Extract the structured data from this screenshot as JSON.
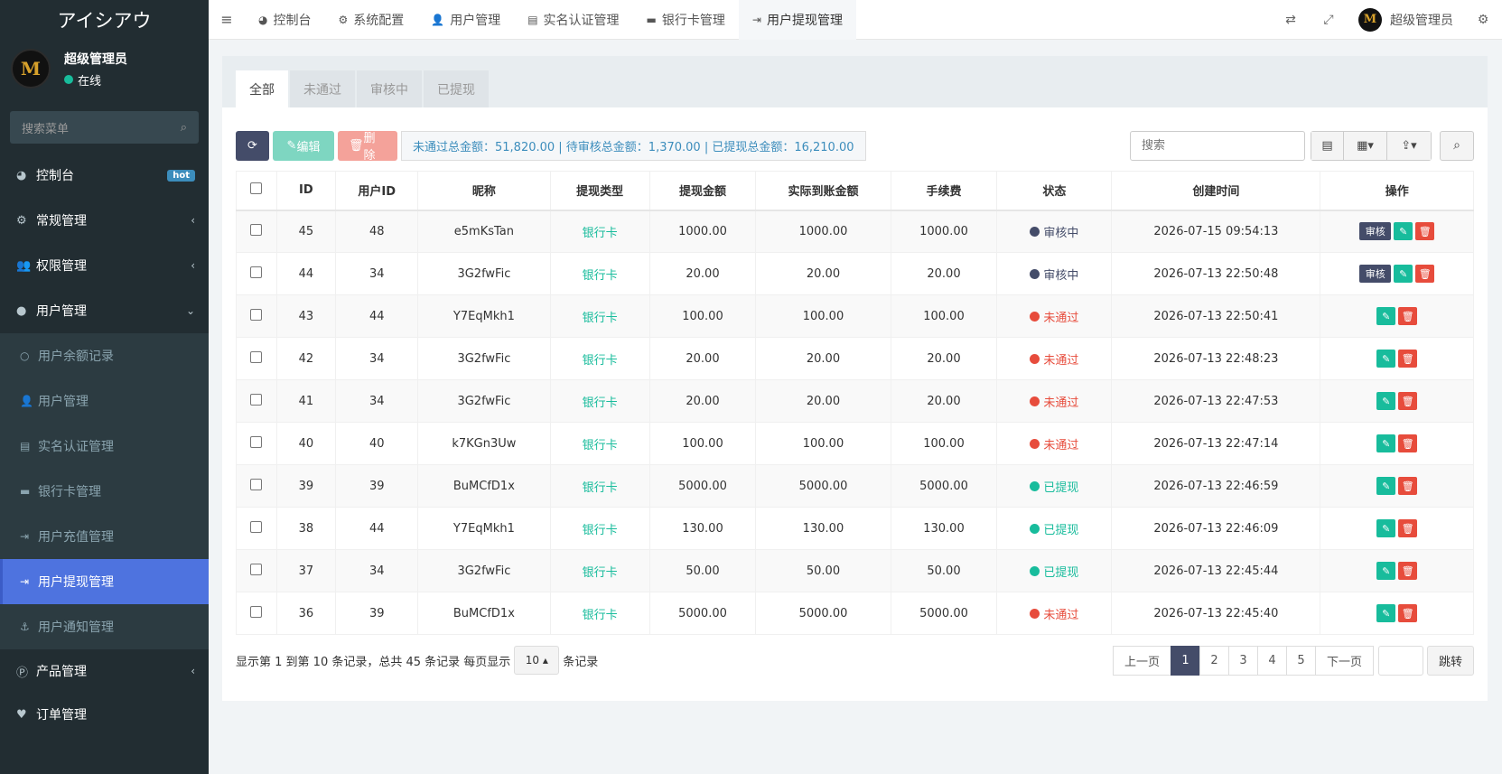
{
  "brand": "アイシアウ",
  "user": {
    "name": "超级管理员",
    "status": "在线",
    "avatar_letter": "M"
  },
  "sidebar": {
    "search_placeholder": "搜索菜单",
    "items": [
      {
        "label": "控制台",
        "icon": "dashboard-icon",
        "glyph": "◕",
        "badge": "hot"
      },
      {
        "label": "常规管理",
        "icon": "cogs-icon",
        "glyph": "⚙",
        "chevron": "‹"
      },
      {
        "label": "权限管理",
        "icon": "group-icon",
        "glyph": "👥",
        "chevron": "‹"
      },
      {
        "label": "用户管理",
        "icon": "user-circle-icon",
        "glyph": "●",
        "chevron": "⌄"
      }
    ],
    "subitems": [
      {
        "label": "用户余额记录",
        "glyph": "○"
      },
      {
        "label": "用户管理",
        "glyph": "👤"
      },
      {
        "label": "实名认证管理",
        "glyph": "▤"
      },
      {
        "label": "银行卡管理",
        "glyph": "▬"
      },
      {
        "label": "用户充值管理",
        "glyph": "⇥"
      },
      {
        "label": "用户提现管理",
        "glyph": "⇥",
        "active": true
      },
      {
        "label": "用户通知管理",
        "glyph": "⚓"
      }
    ],
    "bottom_items": [
      {
        "label": "产品管理",
        "glyph": "Ⓟ",
        "chevron": "‹"
      },
      {
        "label": "订单管理",
        "glyph": "♥"
      }
    ]
  },
  "header": {
    "tabs": [
      {
        "label": "控制台",
        "glyph": "◕"
      },
      {
        "label": "系统配置",
        "glyph": "⚙"
      },
      {
        "label": "用户管理",
        "glyph": "👤"
      },
      {
        "label": "实名认证管理",
        "glyph": "▤"
      },
      {
        "label": "银行卡管理",
        "glyph": "▬"
      },
      {
        "label": "用户提现管理",
        "glyph": "⇥",
        "active": true
      }
    ],
    "admin_name": "超级管理员"
  },
  "panel_tabs": [
    "全部",
    "未通过",
    "审核中",
    "已提现"
  ],
  "toolbar": {
    "edit_label": "编辑",
    "delete_label": "删除",
    "summary": "未通过总金额：51,820.00 | 待审核总金额：1,370.00 | 已提现总金额：16,210.00",
    "search_placeholder": "搜索"
  },
  "table": {
    "headers": [
      "ID",
      "用户ID",
      "昵称",
      "提现类型",
      "提现金额",
      "实际到账金额",
      "手续费",
      "状态",
      "创建时间",
      "操作"
    ],
    "rows": [
      {
        "id": "45",
        "uid": "48",
        "nick": "e5mKsTan",
        "type": "银行卡",
        "amount": "1000.00",
        "actual": "1000.00",
        "fee": "1000.00",
        "status": "审核中",
        "s": "review",
        "time": "2026-07-15 09:54:13"
      },
      {
        "id": "44",
        "uid": "34",
        "nick": "3G2fwFic",
        "type": "银行卡",
        "amount": "20.00",
        "actual": "20.00",
        "fee": "20.00",
        "status": "审核中",
        "s": "review",
        "time": "2026-07-13 22:50:48"
      },
      {
        "id": "43",
        "uid": "44",
        "nick": "Y7EqMkh1",
        "type": "银行卡",
        "amount": "100.00",
        "actual": "100.00",
        "fee": "100.00",
        "status": "未通过",
        "s": "fail",
        "time": "2026-07-13 22:50:41"
      },
      {
        "id": "42",
        "uid": "34",
        "nick": "3G2fwFic",
        "type": "银行卡",
        "amount": "20.00",
        "actual": "20.00",
        "fee": "20.00",
        "status": "未通过",
        "s": "fail",
        "time": "2026-07-13 22:48:23"
      },
      {
        "id": "41",
        "uid": "34",
        "nick": "3G2fwFic",
        "type": "银行卡",
        "amount": "20.00",
        "actual": "20.00",
        "fee": "20.00",
        "status": "未通过",
        "s": "fail",
        "time": "2026-07-13 22:47:53"
      },
      {
        "id": "40",
        "uid": "40",
        "nick": "k7KGn3Uw",
        "type": "银行卡",
        "amount": "100.00",
        "actual": "100.00",
        "fee": "100.00",
        "status": "未通过",
        "s": "fail",
        "time": "2026-07-13 22:47:14"
      },
      {
        "id": "39",
        "uid": "39",
        "nick": "BuMCfD1x",
        "type": "银行卡",
        "amount": "5000.00",
        "actual": "5000.00",
        "fee": "5000.00",
        "status": "已提现",
        "s": "done",
        "time": "2026-07-13 22:46:59"
      },
      {
        "id": "38",
        "uid": "44",
        "nick": "Y7EqMkh1",
        "type": "银行卡",
        "amount": "130.00",
        "actual": "130.00",
        "fee": "130.00",
        "status": "已提现",
        "s": "done",
        "time": "2026-07-13 22:46:09"
      },
      {
        "id": "37",
        "uid": "34",
        "nick": "3G2fwFic",
        "type": "银行卡",
        "amount": "50.00",
        "actual": "50.00",
        "fee": "50.00",
        "status": "已提现",
        "s": "done",
        "time": "2026-07-13 22:45:44"
      },
      {
        "id": "36",
        "uid": "39",
        "nick": "BuMCfD1x",
        "type": "银行卡",
        "amount": "5000.00",
        "actual": "5000.00",
        "fee": "5000.00",
        "status": "未通过",
        "s": "fail",
        "time": "2026-07-13 22:45:40"
      }
    ],
    "review_label": "审核"
  },
  "footer": {
    "info_prefix": "显示第 1 到第 10 条记录，总共 45 条记录 每页显示",
    "page_size": "10",
    "info_suffix": "条记录",
    "prev": "上一页",
    "pages": [
      "1",
      "2",
      "3",
      "4",
      "5"
    ],
    "next": "下一页",
    "jump": "跳转"
  },
  "colors": {
    "accent": "#444c69",
    "success": "#18bc9c",
    "danger": "#e74c3c",
    "sidebar_active": "#4e73df"
  }
}
